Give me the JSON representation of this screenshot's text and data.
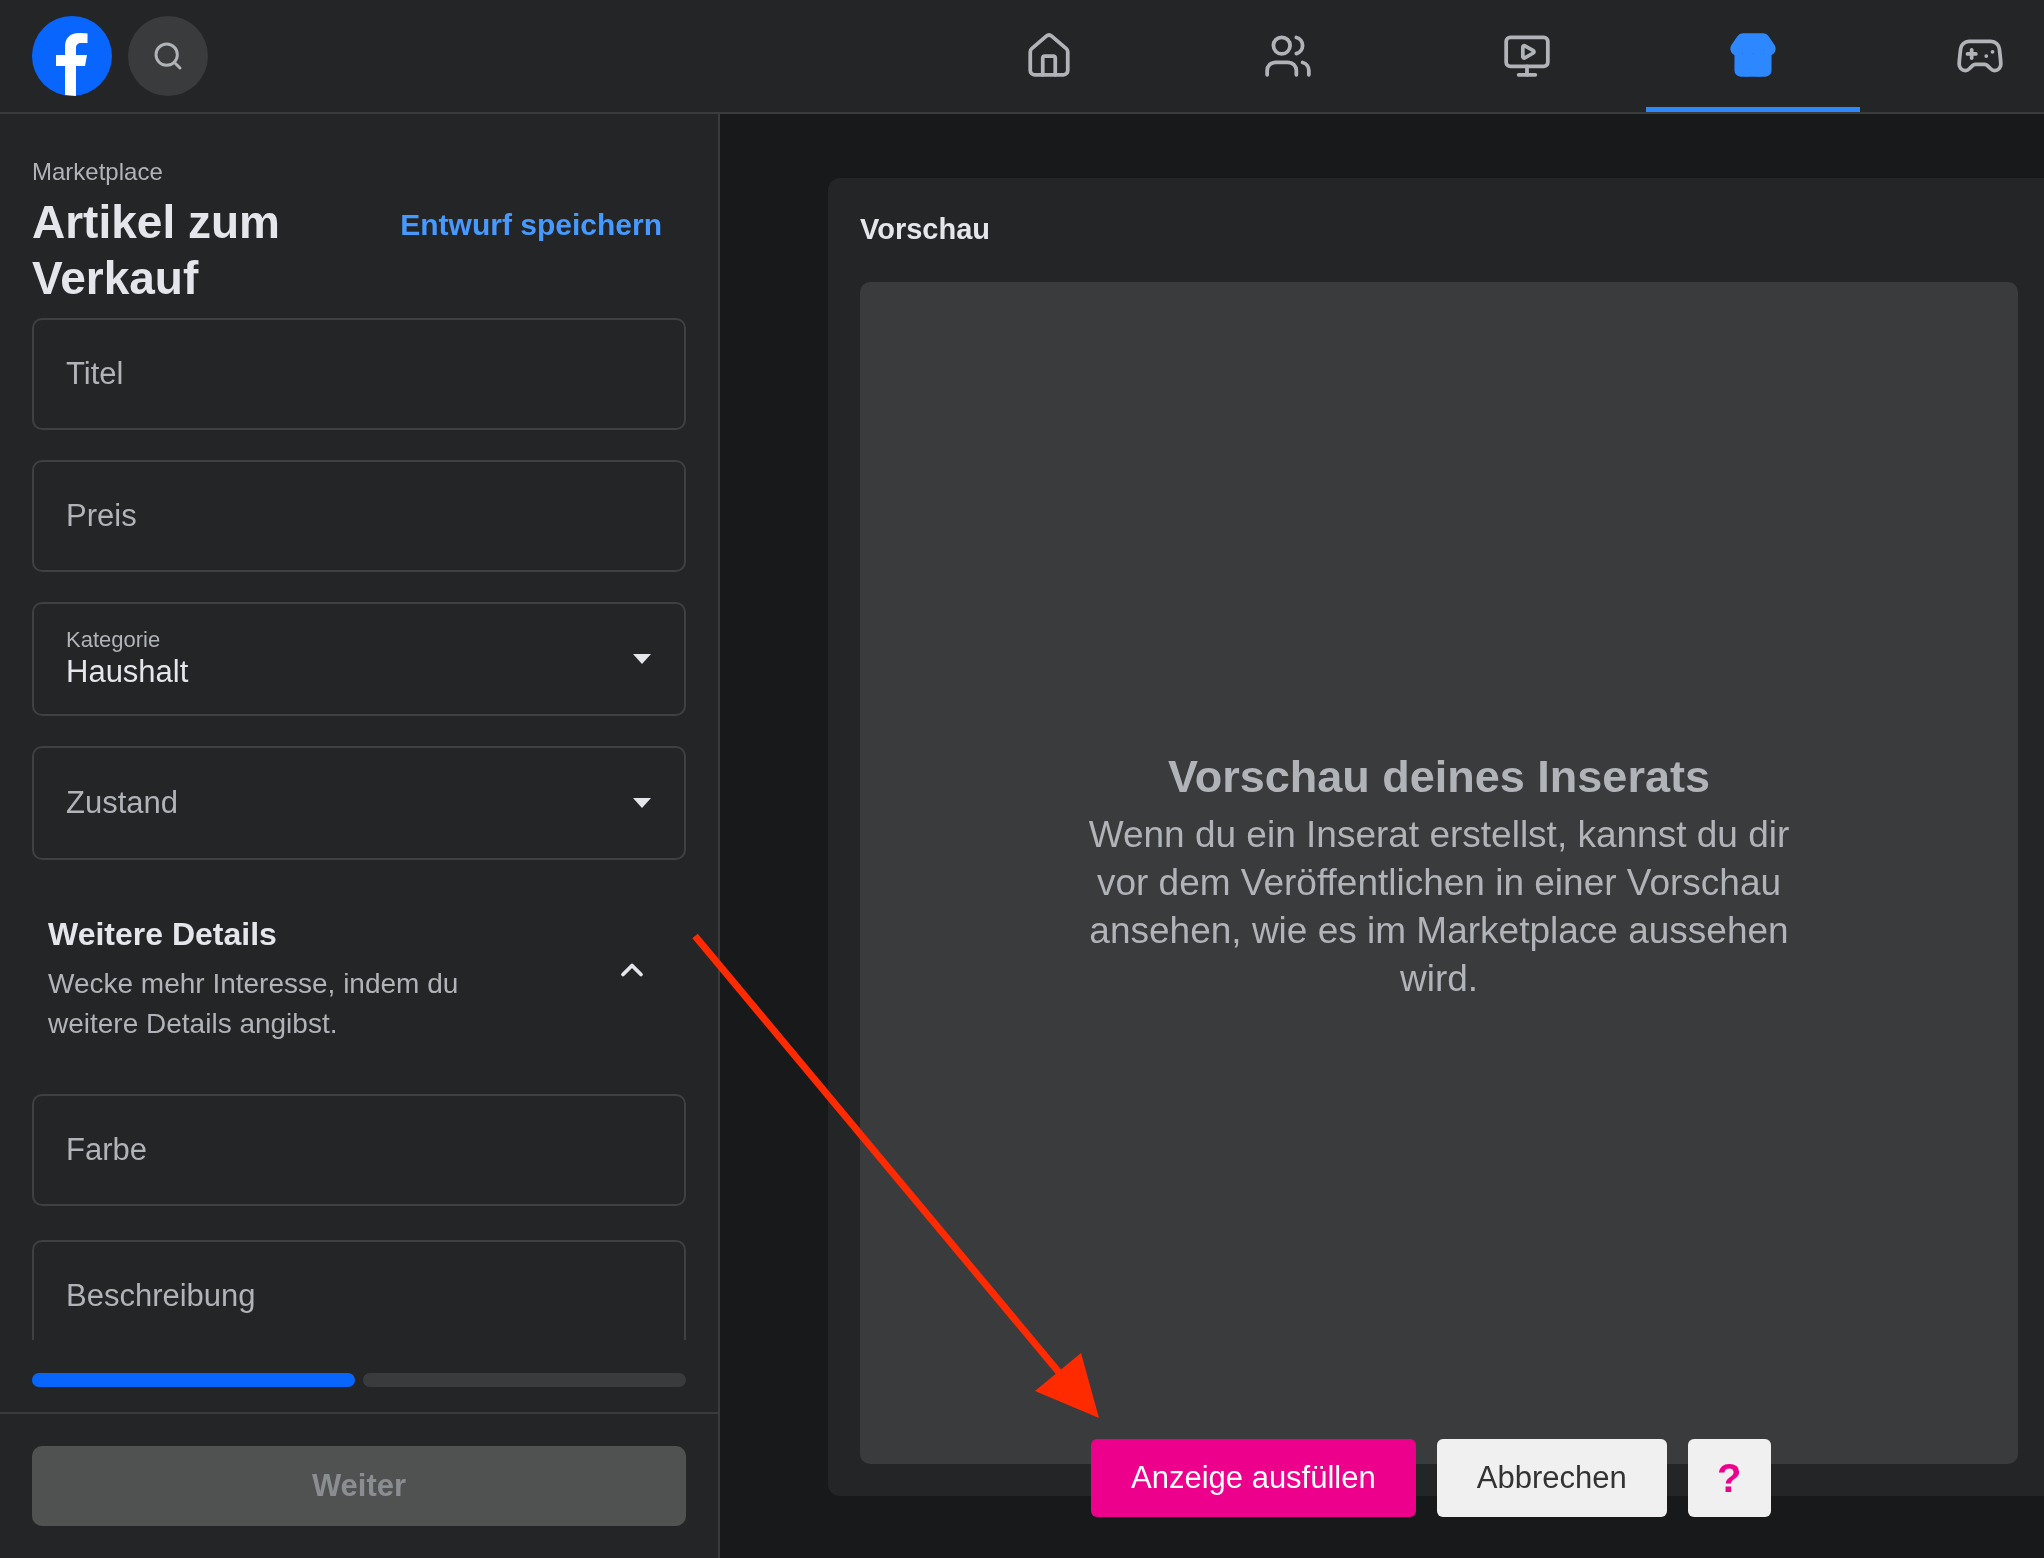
{
  "nav": {
    "tabs": [
      {
        "kind": "home",
        "selected": false
      },
      {
        "kind": "friends",
        "selected": false
      },
      {
        "kind": "video",
        "selected": false
      },
      {
        "kind": "store",
        "selected": true
      },
      {
        "kind": "gaming",
        "selected": false
      }
    ]
  },
  "sidebar": {
    "breadcrumb": "Marketplace",
    "title": "Artikel zum Verkauf",
    "save_link": "Entwurf speichern",
    "fields": [
      {
        "kind": "input",
        "placeholder": "Titel"
      },
      {
        "kind": "input",
        "placeholder": "Preis"
      },
      {
        "kind": "select",
        "label": "Kategorie",
        "value": "Haushalt"
      },
      {
        "kind": "select",
        "placeholder": "Zustand"
      }
    ],
    "details": {
      "title": "Weitere Details",
      "description": "Wecke mehr Interesse, indem du weitere Details angibst.",
      "expanded": true,
      "fields": [
        {
          "kind": "input",
          "placeholder": "Farbe"
        },
        {
          "kind": "input",
          "placeholder": "Beschreibung"
        }
      ]
    },
    "steps": [
      {
        "done": true
      },
      {
        "done": false
      }
    ],
    "next_button": {
      "label": "Weiter",
      "disabled": true
    }
  },
  "preview": {
    "title": "Vorschau",
    "heading": "Vorschau deines Inserats",
    "text": "Wenn du ein Inserat erstellst, kannst du dir vor dem Veröffentlichen in einer Vorschau ansehen, wie es im Marketplace aussehen wird."
  },
  "overlay_buttons": [
    {
      "kind": "primary",
      "label": "Anzeige ausfüllen"
    },
    {
      "kind": "secondary",
      "label": "Abbrechen"
    },
    {
      "kind": "help",
      "label": "?"
    }
  ]
}
